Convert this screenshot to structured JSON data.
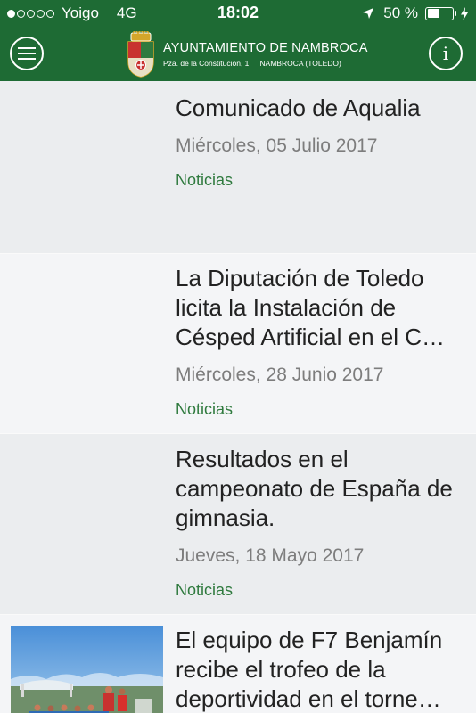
{
  "status_bar": {
    "carrier": "Yoigo",
    "network": "4G",
    "time": "18:02",
    "battery": "50 %",
    "battery_level": 0.5
  },
  "header": {
    "title": "AYUNTAMIENTO DE NAMBROCA",
    "address": "Pza. de la Constitución, 1",
    "town": "NAMBROCA (TOLEDO)",
    "menu_icon": "hamburger-menu-icon",
    "info_icon": "info-icon"
  },
  "news": [
    {
      "title": "Comunicado de Aqualia",
      "date": "Miércoles, 05 Julio 2017",
      "category": "Noticias"
    },
    {
      "title": "La Diputación de Toledo licita la Instalación de Césped Artificial en el C…",
      "date": "Miércoles, 28 Junio 2017",
      "category": "Noticias"
    },
    {
      "title": "Resultados en el campeonato de España de gimnasia.",
      "date": "Jueves, 18 Mayo 2017",
      "category": "Noticias"
    },
    {
      "title": "El equipo de F7 Benjamín recibe el trofeo de la deportividad en el torne…",
      "date": "",
      "category": ""
    }
  ],
  "colors": {
    "brand_green": "#1e6b34",
    "category_green": "#2f7a3e"
  }
}
